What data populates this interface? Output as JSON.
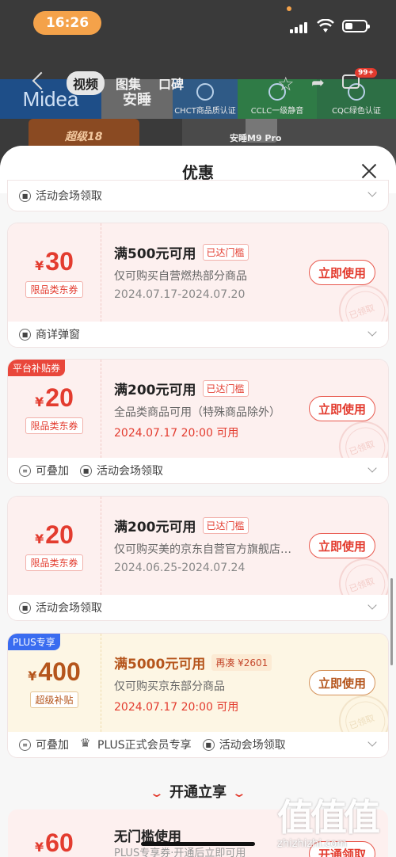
{
  "status_bar": {
    "time": "16:26"
  },
  "nav": {
    "tabs": [
      "视频",
      "图集",
      "口碑"
    ],
    "message_badge": "99+"
  },
  "background": {
    "banner": [
      "Midea",
      "安睡",
      "CHCT商品质认证",
      "CCLC一级静音",
      "CQC绿色认证"
    ],
    "promo": "超级18",
    "product": "安睡M9 Pro"
  },
  "sheet": {
    "title": "优惠",
    "partial_tag": "活动会场领取",
    "coupons": [
      {
        "amount": "30",
        "currency": "¥",
        "tag": "限品类东券",
        "condition": "满500元可用",
        "status": "已达门槛",
        "desc": "仅可购买自营燃热部分商品",
        "date": "2024.07.17-2024.07.20",
        "button": "立即使用",
        "stamp": "已领取",
        "tags": [
          "商详弹窗"
        ]
      },
      {
        "corner": "平台补贴券",
        "amount": "20",
        "currency": "¥",
        "tag": "限品类东券",
        "condition": "满200元可用",
        "status": "已达门槛",
        "desc": "全品类商品可用（特殊商品除外）",
        "date": "2024.07.17 20:00 可用",
        "button": "立即使用",
        "stamp": "已领取",
        "tags": [
          "可叠加",
          "活动会场领取"
        ]
      },
      {
        "amount": "20",
        "currency": "¥",
        "tag": "限品类东券",
        "condition": "满200元可用",
        "status": "已达门槛",
        "desc": "仅可购买美的京东自营官方旗舰店部分商品",
        "date": "2024.06.25-2024.07.24",
        "button": "立即使用",
        "stamp": "已领取",
        "tags": [
          "活动会场领取"
        ]
      },
      {
        "corner": "PLUS专享",
        "amount": "400",
        "currency": "¥",
        "tag": "超级补贴",
        "condition": "满5000元可用",
        "status": "再凑 ¥2601",
        "desc": "仅可购买京东部分商品",
        "date": "2024.07.17 20:00 可用",
        "button": "立即使用",
        "stamp": "已领取",
        "tags": [
          "可叠加",
          "PLUS正式会员专享",
          "活动会场领取"
        ]
      }
    ],
    "section_title": "开通立享",
    "last_coupon": {
      "amount": "60",
      "currency": "¥",
      "condition": "无门槛使用",
      "sub": "PLUS专享券·开通后立即可用",
      "button": "开通领取"
    }
  },
  "watermark": {
    "logo": "值值值",
    "site": "zhizhizhi.com"
  },
  "colors": {
    "accent": "#e33c2f",
    "gold": "#b5551c",
    "coupon_bg": "#fdf0ef",
    "plus_bg": "#fdf6e4"
  }
}
